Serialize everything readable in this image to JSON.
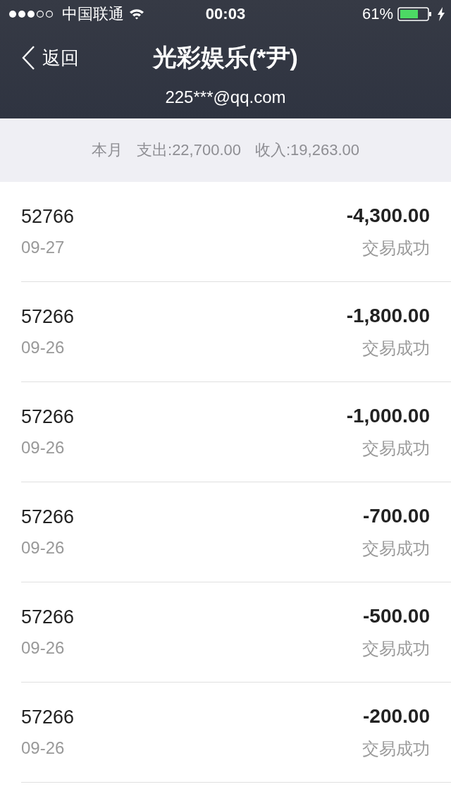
{
  "status_bar": {
    "carrier": "中国联通",
    "time": "00:03",
    "battery": "61%"
  },
  "nav": {
    "back": "返回",
    "title": "光彩娱乐(*尹)",
    "subtitle": "225***@qq.com"
  },
  "summary": {
    "period": "本月",
    "expense": "支出:22,700.00",
    "income": "收入:19,263.00"
  },
  "transactions": [
    {
      "name": "52766",
      "date": "09-27",
      "amount": "-4,300.00",
      "status": "交易成功"
    },
    {
      "name": "57266",
      "date": "09-26",
      "amount": "-1,800.00",
      "status": "交易成功"
    },
    {
      "name": "57266",
      "date": "09-26",
      "amount": "-1,000.00",
      "status": "交易成功"
    },
    {
      "name": "57266",
      "date": "09-26",
      "amount": "-700.00",
      "status": "交易成功"
    },
    {
      "name": "57266",
      "date": "09-26",
      "amount": "-500.00",
      "status": "交易成功"
    },
    {
      "name": "57266",
      "date": "09-26",
      "amount": "-200.00",
      "status": "交易成功"
    }
  ]
}
